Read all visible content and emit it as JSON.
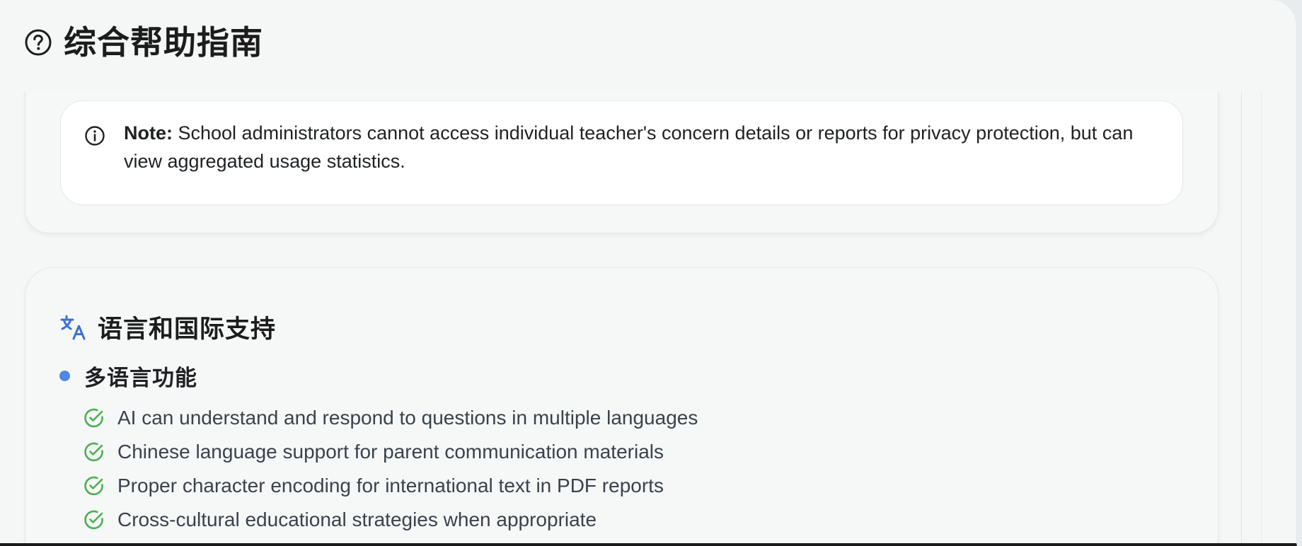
{
  "header": {
    "title": "综合帮助指南",
    "icon": "help-circle-icon"
  },
  "note": {
    "label": "Note:",
    "text": " School administrators cannot access individual teacher's concern details or reports for privacy protection, but can view aggregated usage statistics.",
    "icon": "info-icon"
  },
  "language_section": {
    "title": "语言和国际支持",
    "icon": "translate-icon",
    "accent_color": "#3f6fd8",
    "subsection": {
      "title": "多语言功能",
      "bullet_color": "#4f86e8",
      "items": [
        {
          "text": "AI can understand and respond to questions in multiple languages",
          "icon": "check-circle-icon"
        },
        {
          "text": "Chinese language support for parent communication materials",
          "icon": "check-circle-icon"
        },
        {
          "text": "Proper character encoding for international text in PDF reports",
          "icon": "check-circle-icon"
        },
        {
          "text": "Cross-cultural educational strategies when appropriate",
          "icon": "check-circle-icon"
        }
      ],
      "check_color": "#4caf50"
    }
  }
}
